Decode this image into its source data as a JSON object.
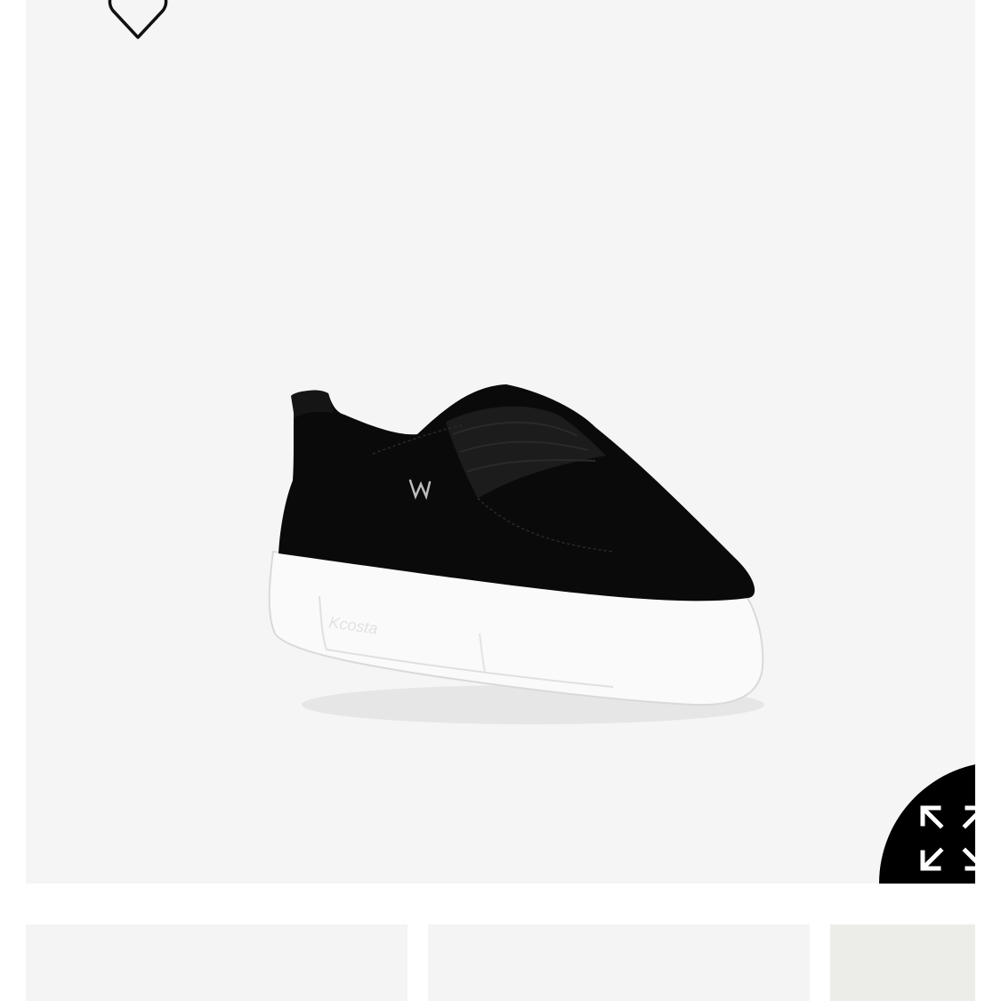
{
  "product_gallery": {
    "image_description_icon": "black-suede-slip-on-sneaker",
    "wishlist_icon": "heart-outline-icon",
    "fullscreen_icon": "expand-arrows-icon",
    "background_color": "#f5f5f5",
    "thumbnail_count": 3
  }
}
